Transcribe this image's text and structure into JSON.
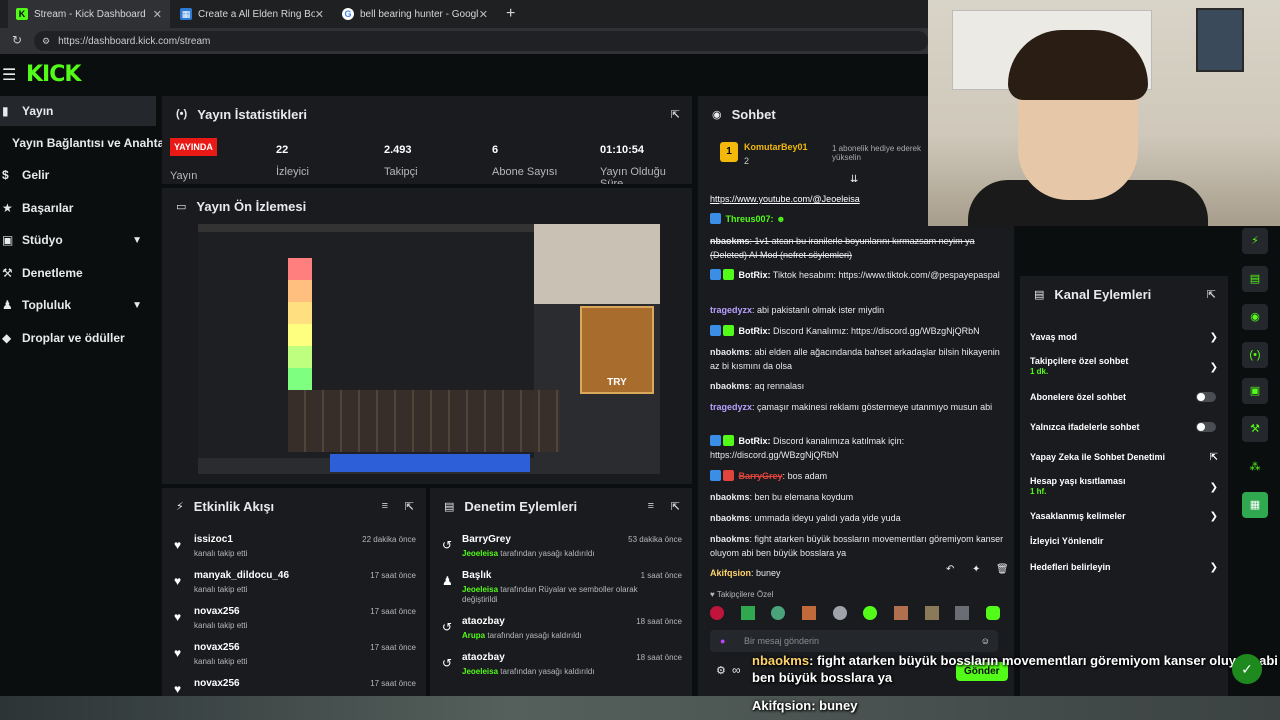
{
  "browser": {
    "tabs": [
      {
        "title": "Stream - Kick Dashboard",
        "icon": "kick-icon"
      },
      {
        "title": "Create a All Elden Ring Bosses Tie",
        "icon": "tiermaker-icon"
      },
      {
        "title": "bell bearing hunter - Google'da A",
        "icon": "google-icon"
      }
    ],
    "new_tab": "+",
    "url": "https://dashboard.kick.com/stream"
  },
  "logo": "KICK",
  "sidebar": {
    "items": [
      {
        "label": "Yayın",
        "icon": "stream-icon"
      },
      {
        "label": "Yayın Bağlantısı ve Anahtarı",
        "icon": ""
      },
      {
        "label": "Gelir",
        "icon": "revenue-icon"
      },
      {
        "label": "Başarılar",
        "icon": "achievements-icon"
      },
      {
        "label": "Stüdyo",
        "icon": "studio-icon"
      },
      {
        "label": "Denetleme",
        "icon": "moderation-icon"
      },
      {
        "label": "Topluluk",
        "icon": "community-icon"
      },
      {
        "label": "Droplar ve ödüller",
        "icon": "drops-icon"
      }
    ]
  },
  "stats": {
    "title": "Yayın İstatistikleri",
    "live_badge": "YAYINDA",
    "live_label": "Yayın",
    "items": [
      {
        "value": "22",
        "label": "İzleyici"
      },
      {
        "value": "2.493",
        "label": "Takipçi"
      },
      {
        "value": "6",
        "label": "Abone Sayısı"
      },
      {
        "value": "01:10:54",
        "label": "Yayın Olduğu Süre"
      }
    ]
  },
  "preview": {
    "title": "Yayın Ön İzlemesi",
    "ad_text": "TRY"
  },
  "activity": {
    "title": "Etkinlik Akışı",
    "items": [
      {
        "name": "issizoc1",
        "sub": "kanalı takip etti",
        "time": "22 dakika önce"
      },
      {
        "name": "manyak_dildocu_46",
        "sub": "kanalı takip etti",
        "time": "17 saat önce"
      },
      {
        "name": "novax256",
        "sub": "kanalı takip etti",
        "time": "17 saat önce"
      },
      {
        "name": "novax256",
        "sub": "kanalı takip etti",
        "time": "17 saat önce"
      },
      {
        "name": "novax256",
        "sub": "",
        "time": "17 saat önce"
      }
    ]
  },
  "moderation": {
    "title": "Denetim Eylemleri",
    "items": [
      {
        "name": "BarryGrey",
        "actor": "Jeoeleisa",
        "rest": "tarafından yasağı kaldırıldı",
        "time": "53 dakika önce"
      },
      {
        "name": "Başlık",
        "actor": "Jeoeleisa",
        "rest": "tarafından Rüyalar ve semboller olarak değiştirildi",
        "time": "1 saat önce"
      },
      {
        "name": "ataozbay",
        "actor": "Arupa",
        "rest": "tarafından yasağı kaldırıldı",
        "time": "18 saat önce"
      },
      {
        "name": "ataozbay",
        "actor": "Jeoeleisa",
        "rest": "tarafından yasağı kaldırıldı",
        "time": "18 saat önce"
      }
    ]
  },
  "chat": {
    "title": "Sohbet",
    "pinned_user": "KomutarBey01",
    "pinned_count": "2",
    "pinned_text": "1 abonelik hediye ederek yükselin",
    "messages": [
      {
        "user": "",
        "text": "https://www.youtube.com/@Jeoeleisa",
        "color": "#ffffff",
        "link": true
      },
      {
        "user": "Threus007:",
        "text": "",
        "color": "#53fc18"
      },
      {
        "user": "nbaokms",
        "text": "1v1 atcan bu iranilerle boyunlarını kırmazsam neyim ya (Deleted) AI Mod (nefret söylemleri)",
        "color": "#ffffff"
      },
      {
        "user": "BotRix:",
        "text": "Tiktok hesabım: https://www.tiktok.com/@pespayepaspal",
        "color": "#53fc18"
      },
      {
        "user": "tragedyzx",
        "text": "abi pakistanlı olmak ister miydin",
        "color": "#b9a0ff"
      },
      {
        "user": "BotRix:",
        "text": "Discord Kanalımız: https://discord.gg/WBzgNjQRbN",
        "color": "#53fc18"
      },
      {
        "user": "nbaokms",
        "text": "abi elden alle ağacındanda bahset arkadaşlar bilsin hikayenin az bi kısmını da olsa",
        "color": "#ffffff"
      },
      {
        "user": "nbaokms",
        "text": "aq rennalası",
        "color": "#ffffff"
      },
      {
        "user": "tragedyzx",
        "text": "çamaşır makinesi reklamı göstermeye utanmıyo musun abi",
        "color": "#b9a0ff"
      },
      {
        "user": "BotRix:",
        "text": "Discord kanalımıza katılmak için: https://discord.gg/WBzgNjQRbN",
        "color": "#53fc18"
      },
      {
        "user": "BarryGrey",
        "text": "bos adam",
        "color": "#e0443c"
      },
      {
        "user": "nbaokms",
        "text": "ben bu elemana koydum",
        "color": "#ffffff"
      },
      {
        "user": "nbaokms",
        "text": "ummada ideyu yalıdı yada yide yuda",
        "color": "#ffffff"
      },
      {
        "user": "nbaokms",
        "text": "fight atarken büyük bossların movementları göremiyom kanser oluyom abi ben büyük bosslara ya",
        "color": "#ffffff"
      },
      {
        "user": "Akifqsion",
        "text": "buney",
        "color": "#ffd36a"
      }
    ],
    "followers_only": "Takipçilere Özel",
    "input_placeholder": "Bir mesaj gönderin",
    "send_label": "Gönder"
  },
  "channel_actions": {
    "title": "Kanal Eylemleri",
    "items": [
      {
        "label": "Yavaş mod",
        "sub": "",
        "control": "arrow"
      },
      {
        "label": "Takipçilere özel sohbet",
        "sub": "1 dk.",
        "control": "arrow"
      },
      {
        "label": "Abonelere özel sohbet",
        "sub": "",
        "control": "toggle"
      },
      {
        "label": "Yalnızca ifadelerle sohbet",
        "sub": "",
        "control": "toggle"
      },
      {
        "label": "Yapay Zeka ile Sohbet Denetimi",
        "sub": "",
        "control": "external"
      },
      {
        "label": "Hesap yaşı kısıtlaması",
        "sub": "1 hf.",
        "control": "arrow"
      },
      {
        "label": "Yasaklanmış kelimeler",
        "sub": "",
        "control": "arrow"
      },
      {
        "label": "İzleyici Yönlendir",
        "sub": "",
        "control": "none"
      },
      {
        "label": "Hedefleri belirleyin",
        "sub": "",
        "control": "arrow"
      }
    ]
  },
  "overlay": {
    "msg1_user": "nbaokms",
    "msg1_text": ": fight atarken büyük bossların movementları göremiyom kanser oluyom abi ben büyük bosslara ya",
    "msg2_user": "Akifqsion",
    "msg2_text": ": buney"
  },
  "colors": {
    "accent": "#53fc18",
    "live": "#e91916",
    "panel": "#191b1f",
    "bg": "#0b0e0f"
  }
}
